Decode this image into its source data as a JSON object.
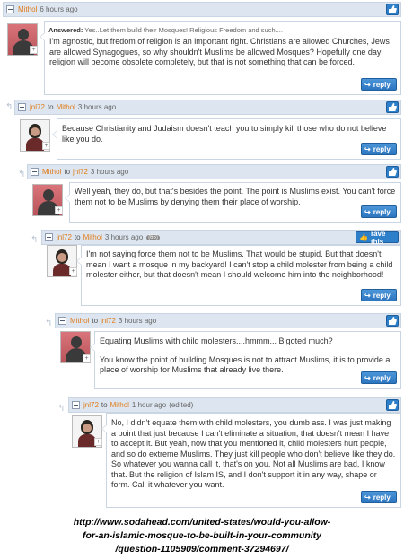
{
  "comments": [
    {
      "author": "Mithol",
      "to": "",
      "time": "6 hours ago",
      "answered_label": "Answered:",
      "answered_text": "Yes..Let them build their Mosques! Religious Freedom and such....",
      "text": "I'm agnostic, but fredom of religion is an important right. Christians are allowed Churches, Jews are allowed Synagogues, so why shouldn't Muslims be allowed Mosques? Hopefully one day religion will become obsolete completely, but that is not something that can be forced.",
      "reply_label": "reply"
    },
    {
      "author": "jnl72",
      "to_word": "to",
      "to": "Mithol",
      "time": "3 hours ago",
      "text": "Because Christianity and Judaism doesn't teach you to simply kill those who do not believe like you do.",
      "reply_label": "reply"
    },
    {
      "author": "Mithol",
      "to_word": "to",
      "to": "jnl72",
      "time": "3 hours ago",
      "text": "Well yeah, they do, but that's besides the point. The point is Muslims exist. You can't force them not to be Muslims by denying them their place of worship.",
      "reply_label": "reply"
    },
    {
      "author": "jnl72",
      "to_word": "to",
      "to": "Mithol",
      "time": "3 hours ago",
      "badge": "(66)",
      "rave_label": "rave this",
      "text": "I'm not saying force them not to be Muslims. That would be stupid. But that doesn't mean I want a mosque in my backyard! I can't stop a child molester from being a child molester either, but that doesn't mean I should welcome him into the neighborhood!",
      "reply_label": "reply"
    },
    {
      "author": "Mithol",
      "to_word": "to",
      "to": "jnl72",
      "time": "3 hours ago",
      "text1": "Equating Muslims with child molesters....hmmm... Bigoted much?",
      "text2": "You know the point of building Mosques is not to attract Muslims, it is to provide a place of worship for Muslims that already live there.",
      "reply_label": "reply"
    },
    {
      "author": "jnl72",
      "to_word": "to",
      "to": "Mithol",
      "time": "1 hour ago",
      "edited": "(edited)",
      "text": "No, I didn't equate them with child molesters, you dumb ass. I was just making a point that just because I can't eliminate a situation, that doesn't mean I have to accept it. But yeah, now that you mentioned it, child molesters hurt people, and so do extreme Muslims. They just kill people who don't believe like they do. So whatever you wanna call it, that's on you. Not all Muslims are bad, I know that. But the religion of Islam IS, and I don't support it in any way, shape or form. Call it whatever you want.",
      "reply_label": "reply"
    }
  ],
  "url_lines": [
    "http://www.sodahead.com/united-states/would-you-allow-",
    "for-an-islamic-mosque-to-be-built-in-your-community",
    "/question-1105909/comment-37294697/"
  ],
  "icons": {
    "thumb": "thumbs-up-icon",
    "reply": "reply-arrow-icon",
    "collapse": "minus-icon"
  },
  "colors": {
    "header_bg": "#dde6f0",
    "username": "#e07b1a",
    "button": "#2e7fc9"
  }
}
